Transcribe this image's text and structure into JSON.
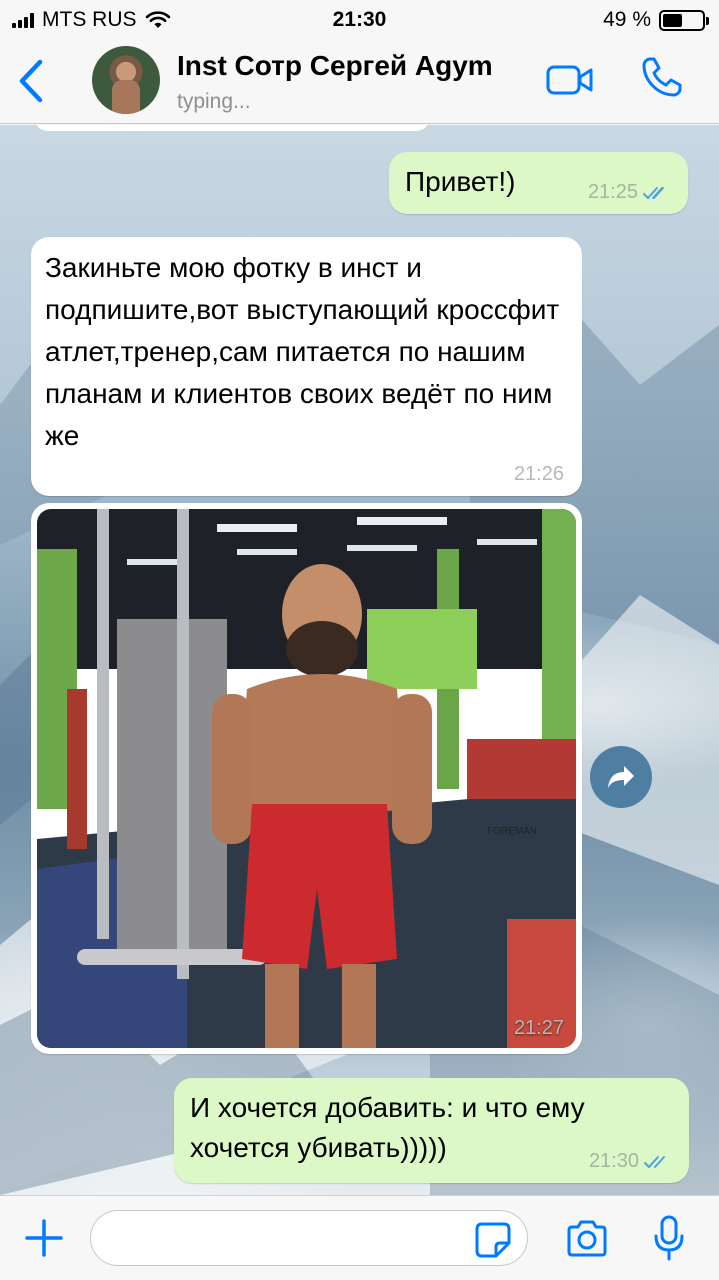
{
  "status_bar": {
    "carrier": "MTS RUS",
    "time": "21:30",
    "battery_text": "49 %",
    "battery_level": 0.49
  },
  "header": {
    "contact_name": "Inst Сотр Сергей Agym",
    "contact_status": "typing...",
    "icons": [
      "chevron-left-icon",
      "avatar",
      "video-camera-icon",
      "phone-icon"
    ]
  },
  "messages": [
    {
      "direction": "outgoing",
      "text": "Привет!)",
      "time": "21:25",
      "status": "read"
    },
    {
      "direction": "incoming",
      "text": "Закиньте мою фотку в инст и подпишите,вот выступающий кроссфит атлет,тренер,сам питается по нашим планам и клиентов своих ведёт по ним же",
      "time": "21:26"
    },
    {
      "direction": "incoming",
      "type": "photo",
      "time": "21:27",
      "photo_text": "FOREMAN"
    },
    {
      "direction": "outgoing",
      "text": "И хочется добавить: и что ему хочется убивать)))))",
      "time": "21:30",
      "status": "read"
    }
  ],
  "input_bar": {
    "placeholder": "",
    "icons": [
      "plus-icon",
      "sticker-icon",
      "camera-icon",
      "microphone-icon"
    ]
  },
  "colors": {
    "accent": "#007aff",
    "outgoing_bubble": "#dcf8c6",
    "incoming_bubble": "#ffffff",
    "read_ticks": "#4fa3e0"
  }
}
